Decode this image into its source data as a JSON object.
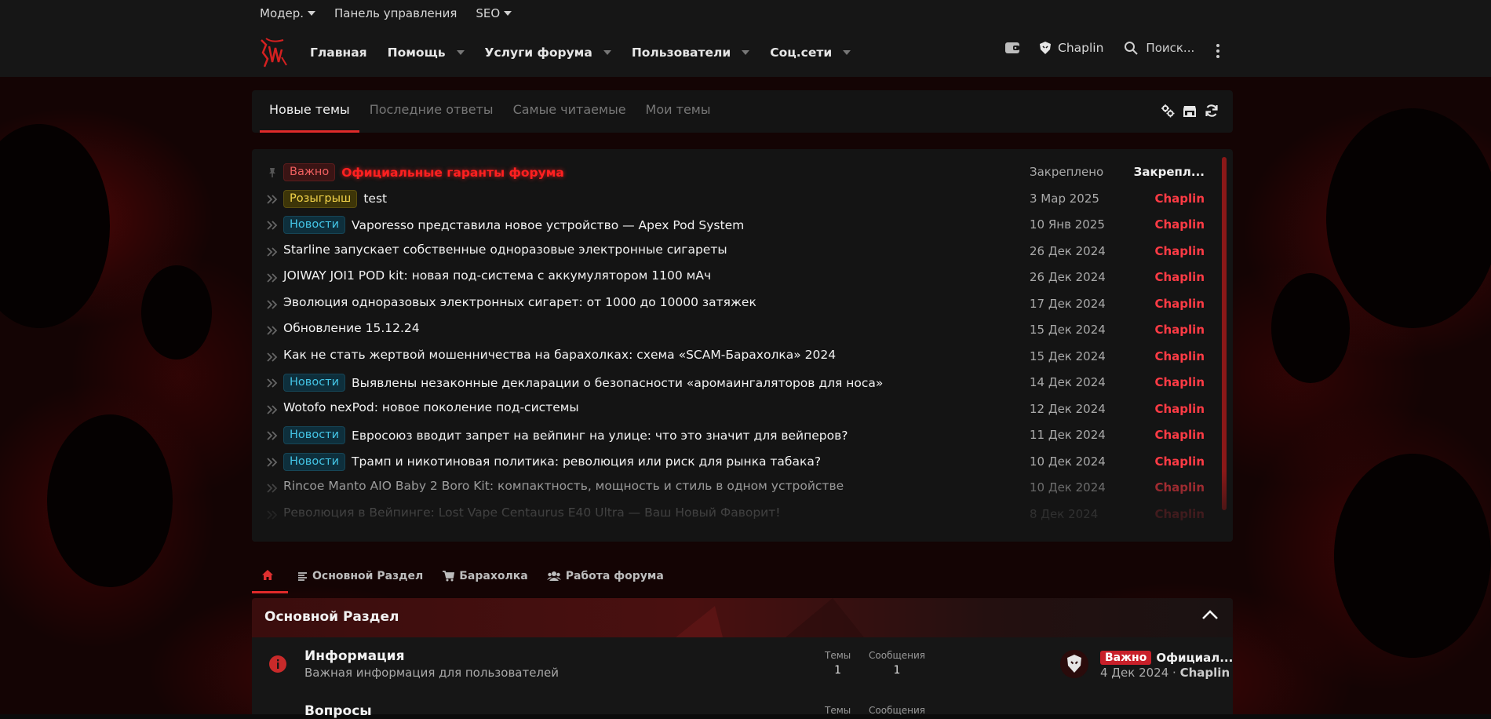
{
  "subnav": {
    "moder": "Модер.",
    "panel": "Панель управления",
    "seo": "SEO"
  },
  "nav": {
    "items": [
      "Главная",
      "Помощь",
      "Услуги форума",
      "Пользователи",
      "Соц.сети"
    ],
    "user": "Chaplin",
    "search_placeholder": "Поиск..."
  },
  "tabs": [
    "Новые темы",
    "Последние ответы",
    "Самые читаемые",
    "Мои темы"
  ],
  "topics": [
    {
      "prefix": "Важно",
      "prefix_type": "imp",
      "title": "Официальные гаранты форума",
      "date": "Закреплено",
      "author": "Закрепл...",
      "pinned": true
    },
    {
      "prefix": "Розыгрыш",
      "prefix_type": "give",
      "title": "test",
      "date": "3 Мар 2025",
      "author": "Chaplin"
    },
    {
      "prefix": "Новости",
      "prefix_type": "news",
      "title": "Vaporesso представила новое устройство — Apex Pod System",
      "date": "10 Янв 2025",
      "author": "Chaplin"
    },
    {
      "prefix": "",
      "prefix_type": "",
      "title": "Starline запускает собственные одноразовые электронные сигареты",
      "date": "26 Дек 2024",
      "author": "Chaplin"
    },
    {
      "prefix": "",
      "prefix_type": "",
      "title": "JOIWAY JOI1 POD kit: новая под-система с аккумулятором 1100 мАч",
      "date": "26 Дек 2024",
      "author": "Chaplin"
    },
    {
      "prefix": "",
      "prefix_type": "",
      "title": "Эволюция одноразовых электронных сигарет: от 1000 до 10000 затяжек",
      "date": "17 Дек 2024",
      "author": "Chaplin"
    },
    {
      "prefix": "",
      "prefix_type": "",
      "title": "Обновление 15.12.24",
      "date": "15 Дек 2024",
      "author": "Chaplin"
    },
    {
      "prefix": "",
      "prefix_type": "",
      "title": "Как не стать жертвой мошенничества на барахолках: схема «SCAM-Барахолка» 2024",
      "date": "15 Дек 2024",
      "author": "Chaplin"
    },
    {
      "prefix": "Новости",
      "prefix_type": "news",
      "title": "Выявлены незаконные декларации о безопасности «аромаингаляторов для носа»",
      "date": "14 Дек 2024",
      "author": "Chaplin"
    },
    {
      "prefix": "",
      "prefix_type": "",
      "title": "Wotofo nexPod: новое поколение под-системы",
      "date": "12 Дек 2024",
      "author": "Chaplin"
    },
    {
      "prefix": "Новости",
      "prefix_type": "news",
      "title": "Евросоюз вводит запрет на вейпинг на улице: что это значит для вейперов?",
      "date": "11 Дек 2024",
      "author": "Chaplin"
    },
    {
      "prefix": "Новости",
      "prefix_type": "news",
      "title": "Трамп и никотиновая политика: революция или риск для рынка табака?",
      "date": "10 Дек 2024",
      "author": "Chaplin"
    },
    {
      "prefix": "",
      "prefix_type": "",
      "title": "Rincoe Manto AIO Baby 2 Boro Kit: компактность, мощность и стиль в одном устройстве",
      "date": "10 Дек 2024",
      "author": "Chaplin"
    },
    {
      "prefix": "",
      "prefix_type": "",
      "title": "Революция в Вейпинге: Lost Vape Centaurus E40 Ultra — Ваш Новый Фаворит!",
      "date": "8 Дек 2024",
      "author": "Chaplin"
    }
  ],
  "section_tabs": [
    "Основной Раздел",
    "Барахолка",
    "Работа форума"
  ],
  "forum": {
    "section_title": "Основной Раздел",
    "node": {
      "title": "Информация",
      "description": "Важная информация для пользователей",
      "threads_label": "Темы",
      "threads": "1",
      "messages_label": "Сообщения",
      "messages": "1",
      "last_prefix": "Важно",
      "last_title": "Официал...",
      "last_date": "4 Дек 2024",
      "last_sep": "·",
      "last_author": "Chaplin"
    },
    "node2": {
      "title": "Вопросы",
      "threads_label": "Темы",
      "messages_label": "Сообщения"
    }
  },
  "colors": {
    "accent": "#e02a2a",
    "author": "#ff3b45",
    "news": "#44c5e6",
    "giveaway": "#f2d34a"
  }
}
